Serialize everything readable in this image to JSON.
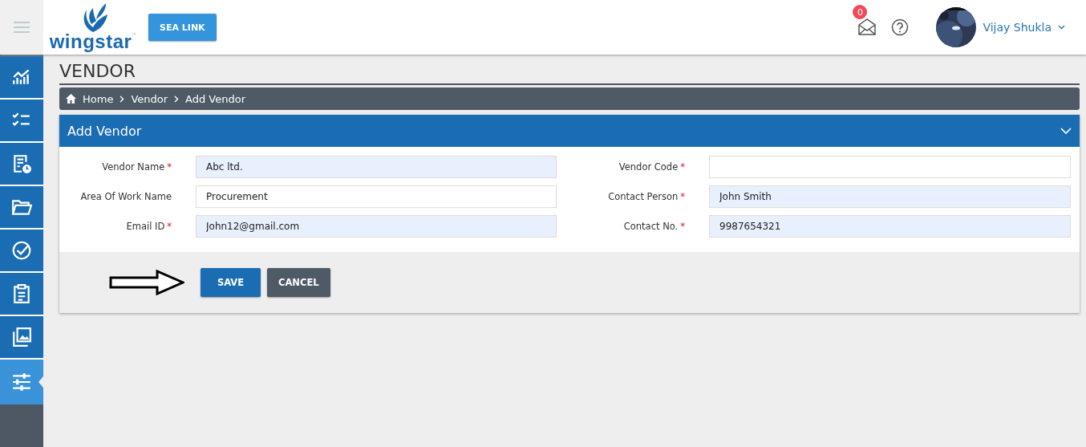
{
  "header": {
    "logo": {
      "text": "wingstar",
      "mark": "™"
    },
    "company_button": "SEA LINK",
    "notifications": {
      "count": "0"
    },
    "user": {
      "name": "Vijay Shukla"
    }
  },
  "sidebar": {
    "items": [
      {
        "kind": "chart",
        "selected": false
      },
      {
        "kind": "checklist",
        "selected": false
      },
      {
        "kind": "report-clock",
        "selected": false
      },
      {
        "kind": "folder",
        "selected": false
      },
      {
        "kind": "check-circle",
        "selected": false
      },
      {
        "kind": "clipboard",
        "selected": false
      },
      {
        "kind": "gallery",
        "selected": false
      },
      {
        "kind": "sliders",
        "selected": true
      }
    ]
  },
  "page_title": "VENDOR",
  "breadcrumb": [
    "Home",
    "Vendor",
    "Add Vendor"
  ],
  "panel": {
    "title": "Add Vendor",
    "fields": [
      {
        "label": "Vendor Name",
        "required_mark": "*",
        "value": "Abc ltd.",
        "highlighted": true
      },
      {
        "label": "Vendor Code",
        "required_mark": "*",
        "highlighted": false
      },
      {
        "label": "Area Of Work Name",
        "value": "Procurement",
        "highlighted": false
      },
      {
        "label": "Contact Person",
        "required_mark": "*",
        "value": "John Smith",
        "highlighted": true
      },
      {
        "label": "Email ID",
        "required_mark": "*",
        "value": "John12@gmail.com",
        "highlighted": true
      },
      {
        "label": "Contact No.",
        "required_mark": "*",
        "value": "9987654321",
        "highlighted": true
      }
    ],
    "buttons": [
      {
        "label": "SAVE",
        "kind": "primary"
      },
      {
        "label": "CANCEL",
        "kind": "secondary"
      }
    ]
  }
}
